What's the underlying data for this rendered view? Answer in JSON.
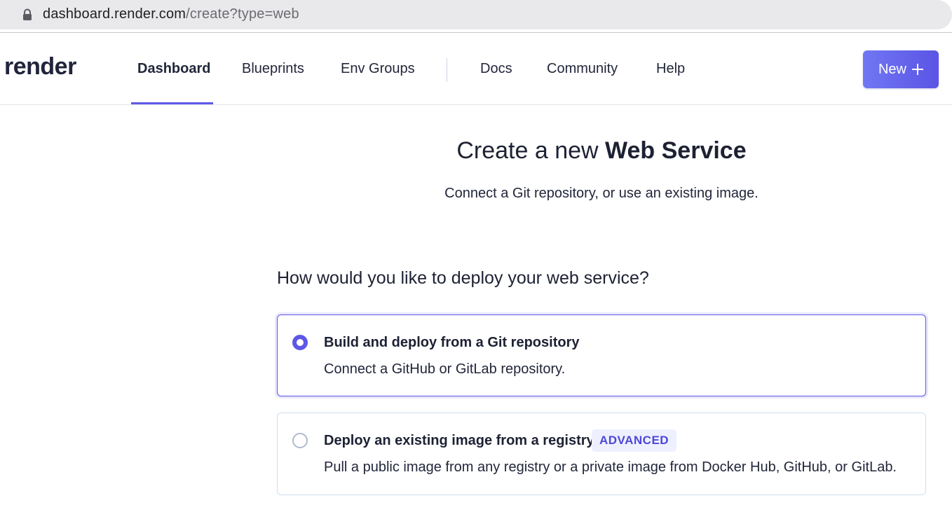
{
  "browser": {
    "url_host": "dashboard.render.com",
    "url_path": "/create?type=web"
  },
  "nav": {
    "logo": "render",
    "items": [
      {
        "label": "Dashboard",
        "active": true
      },
      {
        "label": "Blueprints",
        "active": false
      },
      {
        "label": "Env Groups",
        "active": false
      },
      {
        "label": "Docs",
        "active": false
      },
      {
        "label": "Community",
        "active": false
      },
      {
        "label": "Help",
        "active": false
      }
    ],
    "new_button_label": "New",
    "accent_color": "#5c57e6"
  },
  "main": {
    "title_prefix": "Create a new ",
    "title_bold": "Web Service",
    "subtitle": "Connect a Git repository, or use an existing image.",
    "question": "How would you like to deploy your web service?",
    "options": [
      {
        "title": "Build and deploy from a Git repository",
        "description": "Connect a GitHub or GitLab repository.",
        "selected": true
      },
      {
        "title": "Deploy an existing image from a registry",
        "badge": "ADVANCED",
        "description": "Pull a public image from any registry or a private image from Docker Hub, GitHub, or GitLab.",
        "selected": false
      }
    ]
  }
}
